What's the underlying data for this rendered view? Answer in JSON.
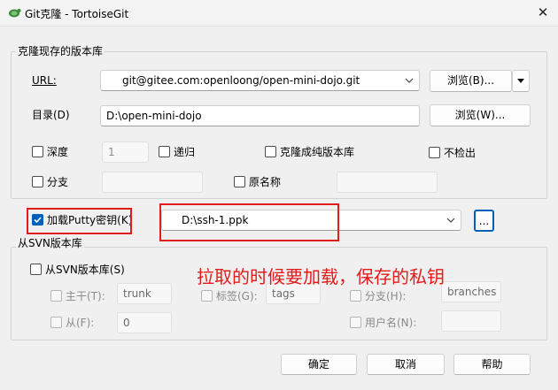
{
  "window": {
    "title": "Git克隆 - TortoiseGit",
    "close_glyph": "✕"
  },
  "clone_group": {
    "title": "克隆现存的版本库",
    "url_label": "URL:",
    "url_value": "git@gitee.com:openloong/open-mini-dojo.git",
    "browse_url_label": "浏览(B)...",
    "dir_label": "目录(D)",
    "dir_value": "D:\\open-mini-dojo",
    "browse_dir_label": "浏览(W)...",
    "depth_label": "深度",
    "depth_value": "1",
    "recursive_label": "递归",
    "bare_label": "克隆成纯版本库",
    "no_checkout_label": "不检出",
    "branch_label": "分支",
    "origin_label": "原名称"
  },
  "putty": {
    "checkbox_label": "加载Putty密钥(K)",
    "checked": true,
    "key_path": "D:\\ssh-1.ppk",
    "browse_label": "..."
  },
  "svn_group": {
    "title": "从SVN版本库",
    "from_svn_label": "从SVN版本库(S)",
    "trunk_label": "主干(T):",
    "trunk_value": "trunk",
    "tags_label": "标签(G):",
    "tags_value": "tags",
    "branches_label": "分支(H):",
    "branches_value": "branches",
    "from_label": "从(F):",
    "from_value": "0",
    "username_label": "用户名(N):"
  },
  "annotation": {
    "text": "拉取的时候要加载，保存的私钥",
    "color": "#e31b1b"
  },
  "footer": {
    "ok_label": "确定",
    "cancel_label": "取消",
    "help_label": "帮助"
  },
  "colors": {
    "accent": "#005fb8",
    "annotation": "#e31b1b"
  }
}
